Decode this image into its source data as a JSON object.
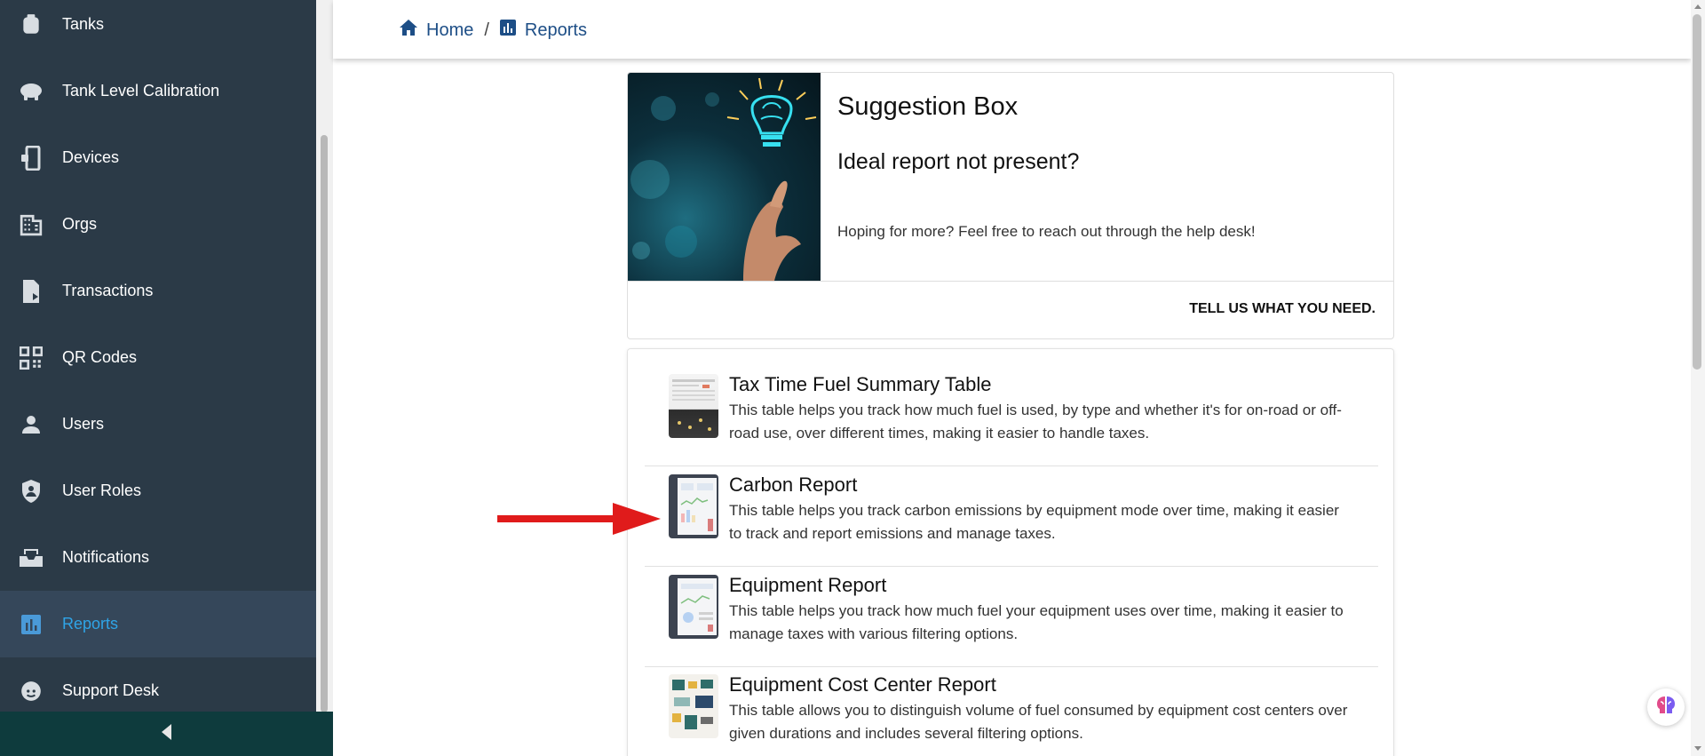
{
  "sidebar": {
    "items": [
      {
        "label": "Tanks",
        "icon": "tank-icon"
      },
      {
        "label": "Tank Level Calibration",
        "icon": "gauge-icon"
      },
      {
        "label": "Devices",
        "icon": "device-icon"
      },
      {
        "label": "Orgs",
        "icon": "building-icon"
      },
      {
        "label": "Transactions",
        "icon": "transaction-icon"
      },
      {
        "label": "QR Codes",
        "icon": "qr-code-icon"
      },
      {
        "label": "Users",
        "icon": "user-icon"
      },
      {
        "label": "User Roles",
        "icon": "shield-icon"
      },
      {
        "label": "Notifications",
        "icon": "inbox-icon"
      },
      {
        "label": "Reports",
        "icon": "chart-icon",
        "active": true
      },
      {
        "label": "Support Desk",
        "icon": "headset-icon"
      }
    ],
    "collapse_icon": "caret-left-icon"
  },
  "breadcrumb": {
    "home": "Home",
    "separator": "/",
    "current": "Reports"
  },
  "suggestion": {
    "title": "Suggestion Box",
    "subtitle": "Ideal report not present?",
    "text": "Hoping for more? Feel free to reach out through the help desk!",
    "link": "TELL US WHAT YOU NEED."
  },
  "reports": [
    {
      "title": "Tax Time Fuel Summary Table",
      "description": "This table helps you track how much fuel is used, by type and whether it's for on-road or off-road use, over different times, making it easier to handle taxes."
    },
    {
      "title": "Carbon Report",
      "description": "This table helps you track carbon emissions by equipment mode over time, making it easier to track and report emissions and manage taxes."
    },
    {
      "title": "Equipment Report",
      "description": "This table helps you track how much fuel your equipment uses over time, making it easier to manage taxes with various filtering options."
    },
    {
      "title": "Equipment Cost Center Report",
      "description": "This table allows you to distinguish volume of fuel consumed by equipment cost centers over given durations and includes several filtering options."
    }
  ],
  "colors": {
    "sidebar_bg": "#2b3a47",
    "active_text": "#2fa4e7",
    "breadcrumb_link": "#1d4e86",
    "annotation_arrow": "#e01b1b"
  }
}
